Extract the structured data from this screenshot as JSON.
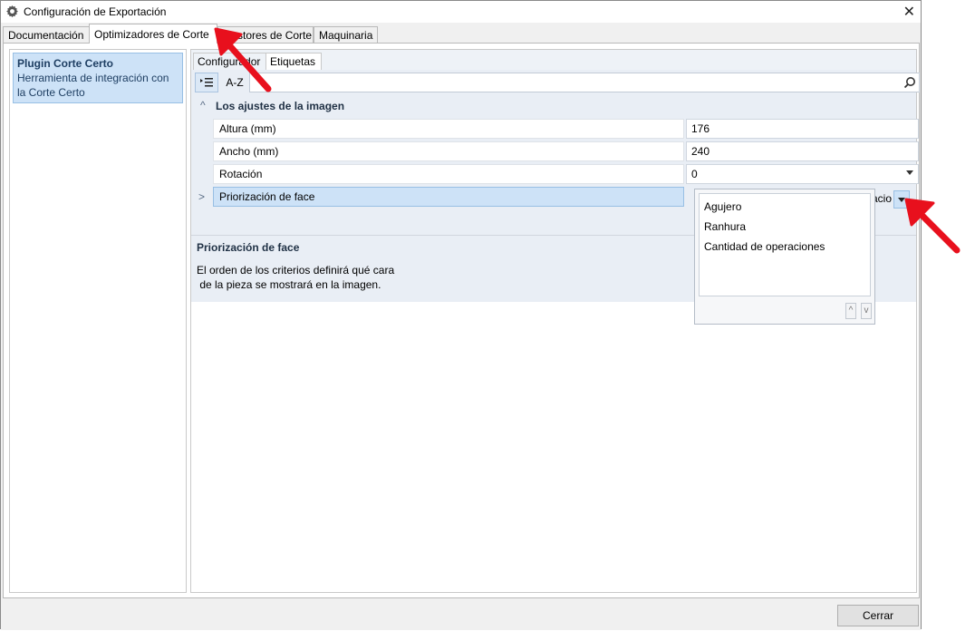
{
  "window": {
    "title": "Configuración de Exportación",
    "close_label": "✕"
  },
  "tabs": [
    {
      "label": "Documentación"
    },
    {
      "label": "Optimizadores de Corte",
      "active": true
    },
    {
      "label": "Gestores de Corte"
    },
    {
      "label": "Maquinaria"
    }
  ],
  "plugin": {
    "name": "Plugin Corte Certo",
    "description": "Herramienta de integración con la Corte Certo"
  },
  "inner_tabs": [
    {
      "label": "Configurador"
    },
    {
      "label": "Etiquetas",
      "active": true
    }
  ],
  "toolbar": {
    "az_label": "A-Z"
  },
  "category": {
    "label": "Los ajustes de la imagen"
  },
  "properties": [
    {
      "name": "Altura (mm)",
      "value": "176"
    },
    {
      "name": "Ancho (mm)",
      "value": "240"
    },
    {
      "name": "Rotación",
      "value": "0"
    },
    {
      "name": "Priorización de face",
      "value": "acio"
    }
  ],
  "description": {
    "title": "Priorización de face",
    "text_line1": "El orden de los criterios definirá qué cara",
    "text_line2": " de la pieza se mostrará en la imagen."
  },
  "popup": {
    "items": [
      "Agujero",
      "Ranhura",
      "Cantidad de operaciones"
    ],
    "up_label": "^",
    "down_label": "v"
  },
  "footer": {
    "close_button": "Cerrar"
  },
  "colors": {
    "selection": "#cde2f7",
    "annotation_arrow": "#e8101d"
  }
}
